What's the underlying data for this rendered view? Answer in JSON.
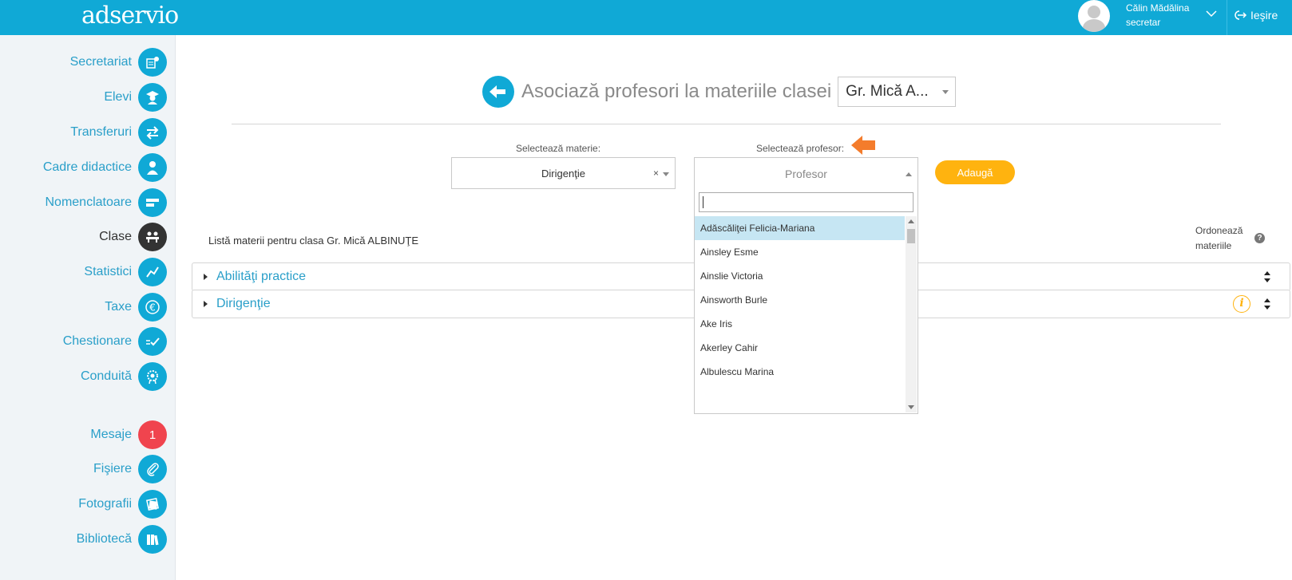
{
  "topbar": {
    "logo": "adservio",
    "user_name": "Călin Mădălina",
    "user_role": "secretar",
    "logout": "Ieşire"
  },
  "sidebar": {
    "items": [
      {
        "label": "Secretariat",
        "icon": "secretariat-icon"
      },
      {
        "label": "Elevi",
        "icon": "student-icon"
      },
      {
        "label": "Transferuri",
        "icon": "transfer-icon"
      },
      {
        "label": "Cadre didactice",
        "icon": "teacher-icon"
      },
      {
        "label": "Nomenclatoare",
        "icon": "nomenclature-icon"
      },
      {
        "label": "Clase",
        "icon": "classroom-icon"
      },
      {
        "label": "Statistici",
        "icon": "statistics-icon"
      },
      {
        "label": "Taxe",
        "icon": "euro-icon"
      },
      {
        "label": "Chestionare",
        "icon": "questionnaire-icon"
      },
      {
        "label": "Conduită",
        "icon": "conduct-icon"
      },
      {
        "label": "Mesaje",
        "icon": "messages-badge",
        "badge": "1"
      },
      {
        "label": "Fişiere",
        "icon": "paperclip-icon"
      },
      {
        "label": "Fotografii",
        "icon": "photos-icon"
      },
      {
        "label": "Bibliotecă",
        "icon": "library-icon"
      }
    ],
    "active": "Clase"
  },
  "main": {
    "title": "Asociază profesori la materiile clasei",
    "class_select": "Gr. Mică A...",
    "label_materie": "Selectează materie:",
    "label_profesor": "Selectează profesor:",
    "materie_value": "Dirigenţie",
    "profesor_placeholder": "Profesor",
    "add_button": "Adaugă",
    "list_title": "Listă materii pentru clasa Gr. Mică ALBINUŢE",
    "order_label_line1": "Ordonează",
    "order_label_line2": "materiile",
    "subjects": [
      {
        "name": "Abilităţi practice"
      },
      {
        "name": "Dirigenţie"
      }
    ]
  },
  "dropdown": {
    "search_value": "",
    "items": [
      "Adăscăliţei Felicia-Mariana",
      "Ainsley Esme",
      "Ainslie Victoria",
      "Ainsworth Burle",
      "Ake Iris",
      "Akerley Cahir",
      "Albulescu Marina"
    ],
    "highlighted_index": 0
  },
  "colors": {
    "primary": "#10a9d6",
    "accent": "#ffb30f",
    "badge": "#f0444e",
    "arrow": "#f47c2c"
  }
}
